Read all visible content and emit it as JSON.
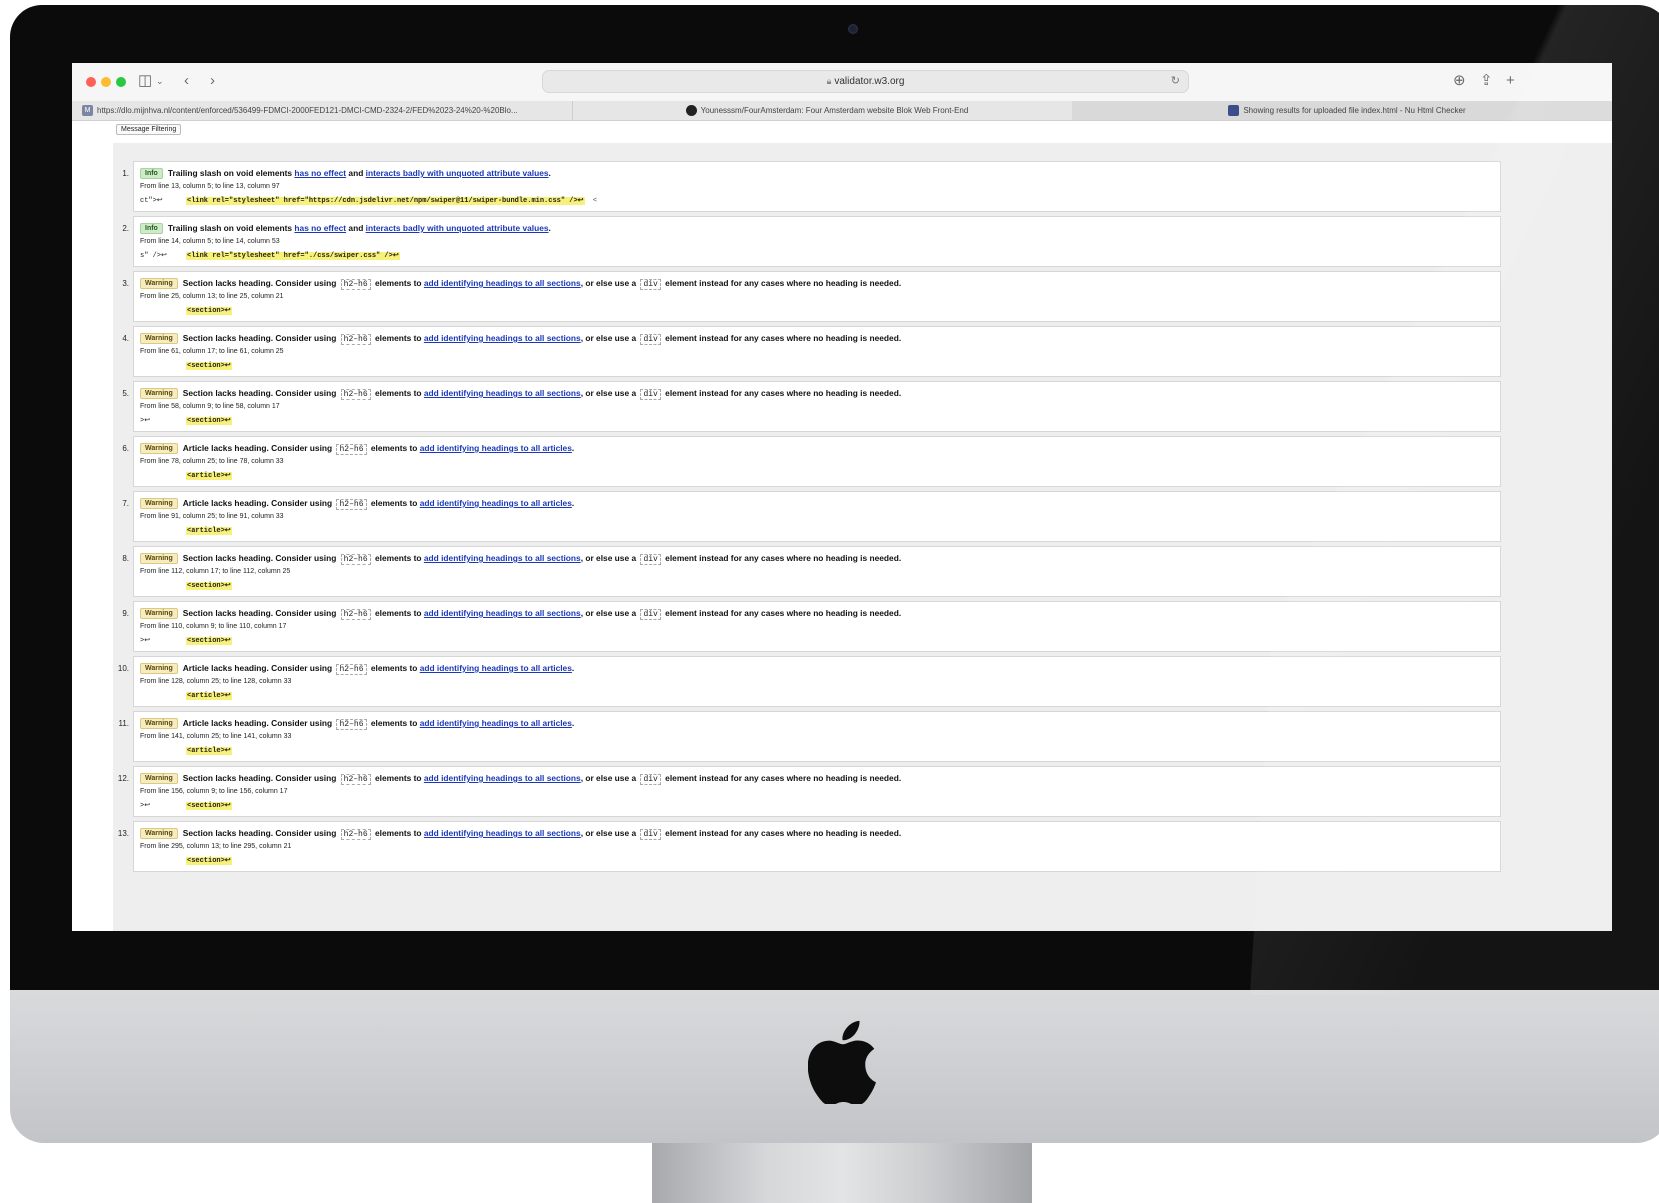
{
  "browser": {
    "address": "validator.w3.org",
    "tabs": [
      {
        "favicon": "M",
        "title": "https://dlo.mijnhva.nl/content/enforced/536499-FDMCI-2000FED121-DMCI-CMD-2324-2/FED%2023-24%20-%20Blo..."
      },
      {
        "favicon": "github-icon",
        "title": "Younesssm/FourAmsterdam: Four Amsterdam website Blok Web Front-End"
      },
      {
        "favicon": "validator-icon",
        "title": "Showing results for uploaded file index.html - Nu Html Checker"
      }
    ]
  },
  "page": {
    "filter_label": "Message Filtering"
  },
  "phrases": {
    "trailing_slash": "Trailing slash on void elements",
    "has_no_effect": "has no effect",
    "and": " and ",
    "interacts_badly": "interacts badly with unquoted attribute values",
    "period": ".",
    "section_lacks": "Section lacks heading. Consider using",
    "article_lacks": "Article lacks heading. Consider using",
    "h2_h6": "h2–h6",
    "elements_to": "elements to",
    "add_sections": "add identifying headings to all sections",
    "or_else": ", or else use a",
    "div": "div",
    "element_instead": "element instead for any cases where no heading is needed.",
    "add_articles": "add identifying headings to all articles"
  },
  "messages": [
    {
      "num": "1.",
      "type": "Info",
      "kind": "slash",
      "location": "From line 13, column 5; to line 13, column 97",
      "ext_pre": "ct\">↩",
      "ext_code": "<link rel=\"stylesheet\" href=\"https://cdn.jsdelivr.net/npm/swiper@11/swiper-bundle.min.css\" />↩",
      "ext_post": "  <"
    },
    {
      "num": "2.",
      "type": "Info",
      "kind": "slash",
      "location": "From line 14, column 5; to line 14, column 53",
      "ext_pre": "s\" />↩",
      "ext_code": "<link rel=\"stylesheet\" href=\"./css/swiper.css\" />↩",
      "ext_post": ""
    },
    {
      "num": "3.",
      "type": "Warning",
      "kind": "section",
      "location": "From line 25, column 13; to line 25, column 21",
      "ext_pre": "",
      "ext_code": "<section>↩",
      "ext_post": ""
    },
    {
      "num": "4.",
      "type": "Warning",
      "kind": "section",
      "location": "From line 61, column 17; to line 61, column 25",
      "ext_pre": "",
      "ext_code": "<section>↩",
      "ext_post": ""
    },
    {
      "num": "5.",
      "type": "Warning",
      "kind": "section",
      "location": "From line 58, column 9; to line 58, column 17",
      "ext_pre": ">↩",
      "ext_code": "<section>↩",
      "ext_post": ""
    },
    {
      "num": "6.",
      "type": "Warning",
      "kind": "article",
      "location": "From line 78, column 25; to line 78, column 33",
      "ext_pre": "",
      "ext_code": "<article>↩",
      "ext_post": ""
    },
    {
      "num": "7.",
      "type": "Warning",
      "kind": "article",
      "location": "From line 91, column 25; to line 91, column 33",
      "ext_pre": "",
      "ext_code": "<article>↩",
      "ext_post": ""
    },
    {
      "num": "8.",
      "type": "Warning",
      "kind": "section",
      "location": "From line 112, column 17; to line 112, column 25",
      "ext_pre": "",
      "ext_code": "<section>↩",
      "ext_post": ""
    },
    {
      "num": "9.",
      "type": "Warning",
      "kind": "section",
      "location": "From line 110, column 9; to line 110, column 17",
      "ext_pre": ">↩",
      "ext_code": "<section>↩",
      "ext_post": ""
    },
    {
      "num": "10.",
      "type": "Warning",
      "kind": "article",
      "location": "From line 128, column 25; to line 128, column 33",
      "ext_pre": "",
      "ext_code": "<article>↩",
      "ext_post": ""
    },
    {
      "num": "11.",
      "type": "Warning",
      "kind": "article",
      "location": "From line 141, column 25; to line 141, column 33",
      "ext_pre": "",
      "ext_code": "<article>↩",
      "ext_post": ""
    },
    {
      "num": "12.",
      "type": "Warning",
      "kind": "section",
      "location": "From line 156, column 9; to line 156, column 17",
      "ext_pre": ">↩",
      "ext_code": "<section>↩",
      "ext_post": ""
    },
    {
      "num": "13.",
      "type": "Warning",
      "kind": "section",
      "location": "From line 295, column 13; to line 295, column 21",
      "ext_pre": "",
      "ext_code": "<section>↩",
      "ext_post": ""
    }
  ],
  "colors": {
    "info_badge": "#cfeac9",
    "warning_badge": "#f6ecc4",
    "link": "#1a38b8",
    "highlight": "#f7f079"
  }
}
